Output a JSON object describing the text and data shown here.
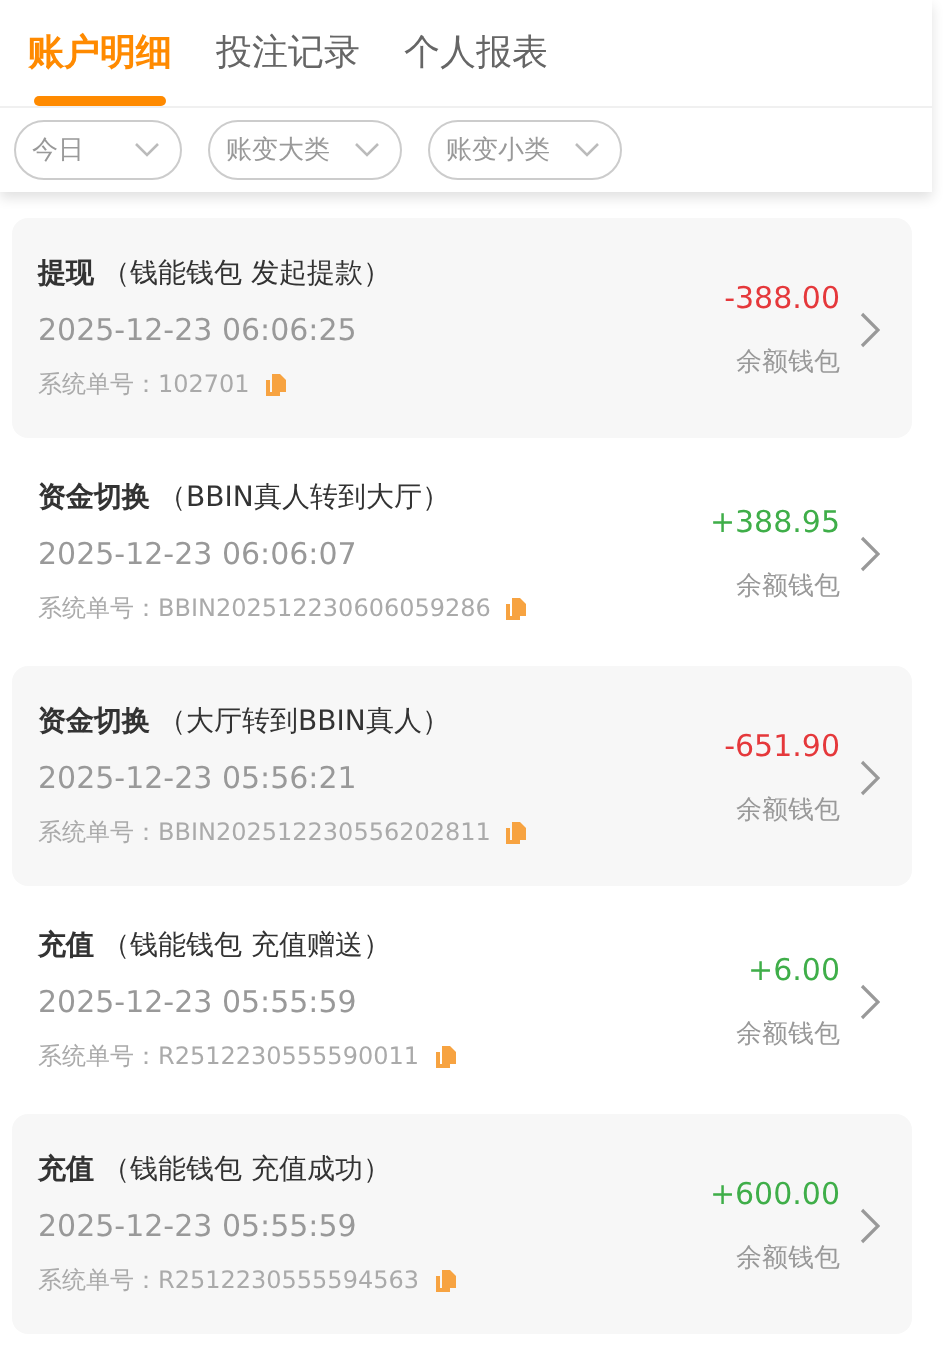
{
  "tabs": [
    {
      "label": "账户明细",
      "selected": true
    },
    {
      "label": "投注记录",
      "selected": false
    },
    {
      "label": "个人报表",
      "selected": false
    }
  ],
  "filters": [
    {
      "label": "今日"
    },
    {
      "label": "账变大类"
    },
    {
      "label": "账变小类"
    }
  ],
  "records": [
    {
      "type": "提现",
      "note": "（钱能钱包 发起提款）",
      "time": "2025-12-23 06:06:25",
      "order_no": "系统单号：102701",
      "amount": "-388.00",
      "color": "#e5383b",
      "wallet": "余额钱包"
    },
    {
      "type": "资金切换",
      "note": "（BBIN真人转到大厅）",
      "time": "2025-12-23 06:06:07",
      "order_no": "系统单号：BBIN202512230606059286",
      "amount": "+388.95",
      "color": "#3fae49",
      "wallet": "余额钱包"
    },
    {
      "type": "资金切换",
      "note": "（大厅转到BBIN真人）",
      "time": "2025-12-23 05:56:21",
      "order_no": "系统单号：BBIN202512230556202811",
      "amount": "-651.90",
      "color": "#e5383b",
      "wallet": "余额钱包"
    },
    {
      "type": "充值",
      "note": "（钱能钱包 充值赠送）",
      "time": "2025-12-23 05:55:59",
      "order_no": "系统单号：R2512230555590011",
      "amount": "+6.00",
      "color": "#3fae49",
      "wallet": "余额钱包"
    },
    {
      "type": "充值",
      "note": "（钱能钱包 充值成功）",
      "time": "2025-12-23 05:55:59",
      "order_no": "系统单号：R2512230555594563",
      "amount": "+600.00",
      "color": "#3fae49",
      "wallet": "余额钱包"
    }
  ]
}
